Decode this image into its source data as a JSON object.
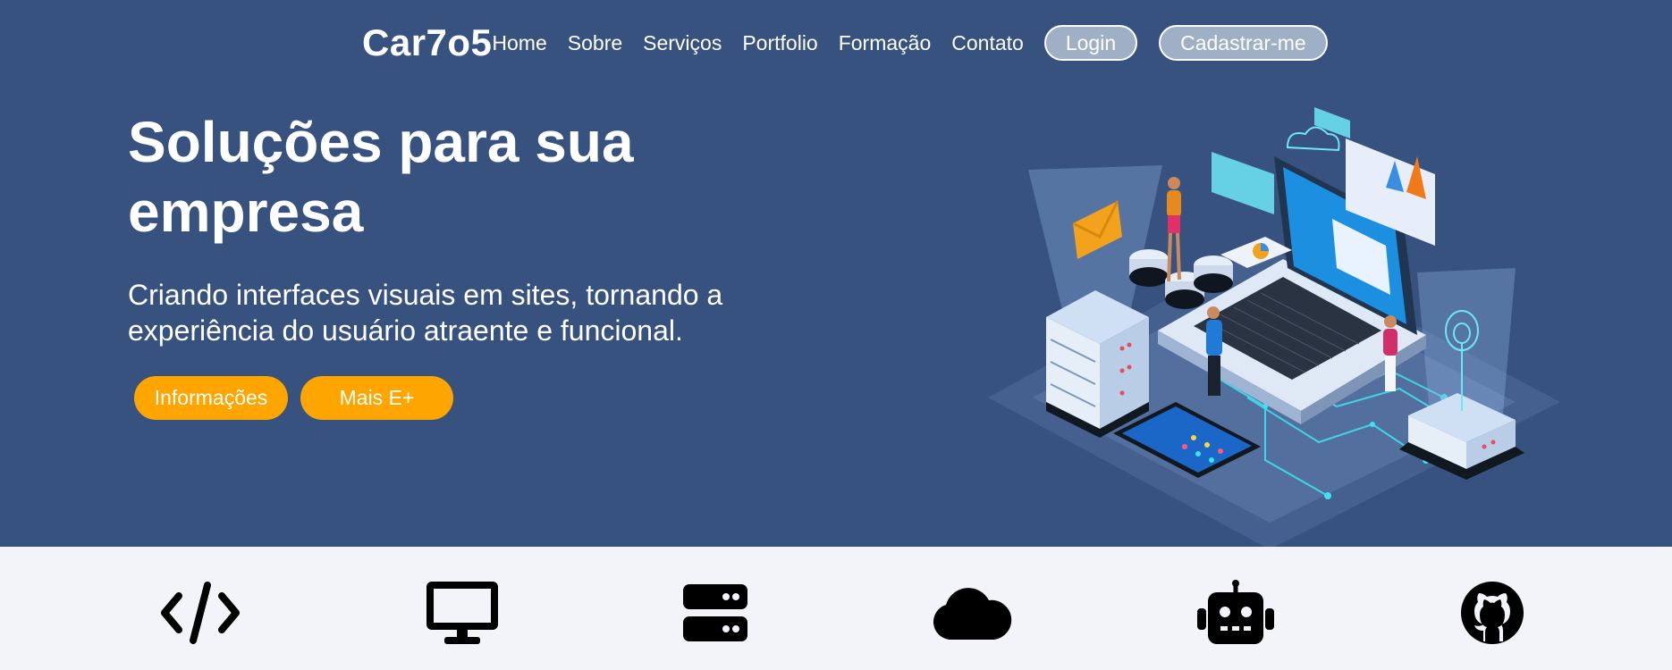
{
  "brand": {
    "logo": "Car7o5"
  },
  "nav": {
    "links": [
      "Home",
      "Sobre",
      "Serviços",
      "Portfolio",
      "Formação",
      "Contato"
    ],
    "login_label": "Login",
    "signup_label": "Cadastrar-me"
  },
  "hero": {
    "title_line1": "Soluções para sua",
    "title_line2": "empresa",
    "subtitle_line1": "Criando interfaces visuais em sites, tornando a",
    "subtitle_line2": "experiência do usuário atraente e funcional.",
    "buttons": [
      "Informações",
      "Mais E+"
    ],
    "illustration": "isometric-tech-illustration"
  },
  "features": {
    "icons": [
      "code-icon",
      "monitor-icon",
      "server-icon",
      "cloud-icon",
      "robot-icon",
      "github-icon"
    ]
  },
  "colors": {
    "hero_bg": "#37527f",
    "accent": "#ffa500",
    "pill_bg": "#9fb0c6",
    "features_bg": "#f2f4f9"
  }
}
